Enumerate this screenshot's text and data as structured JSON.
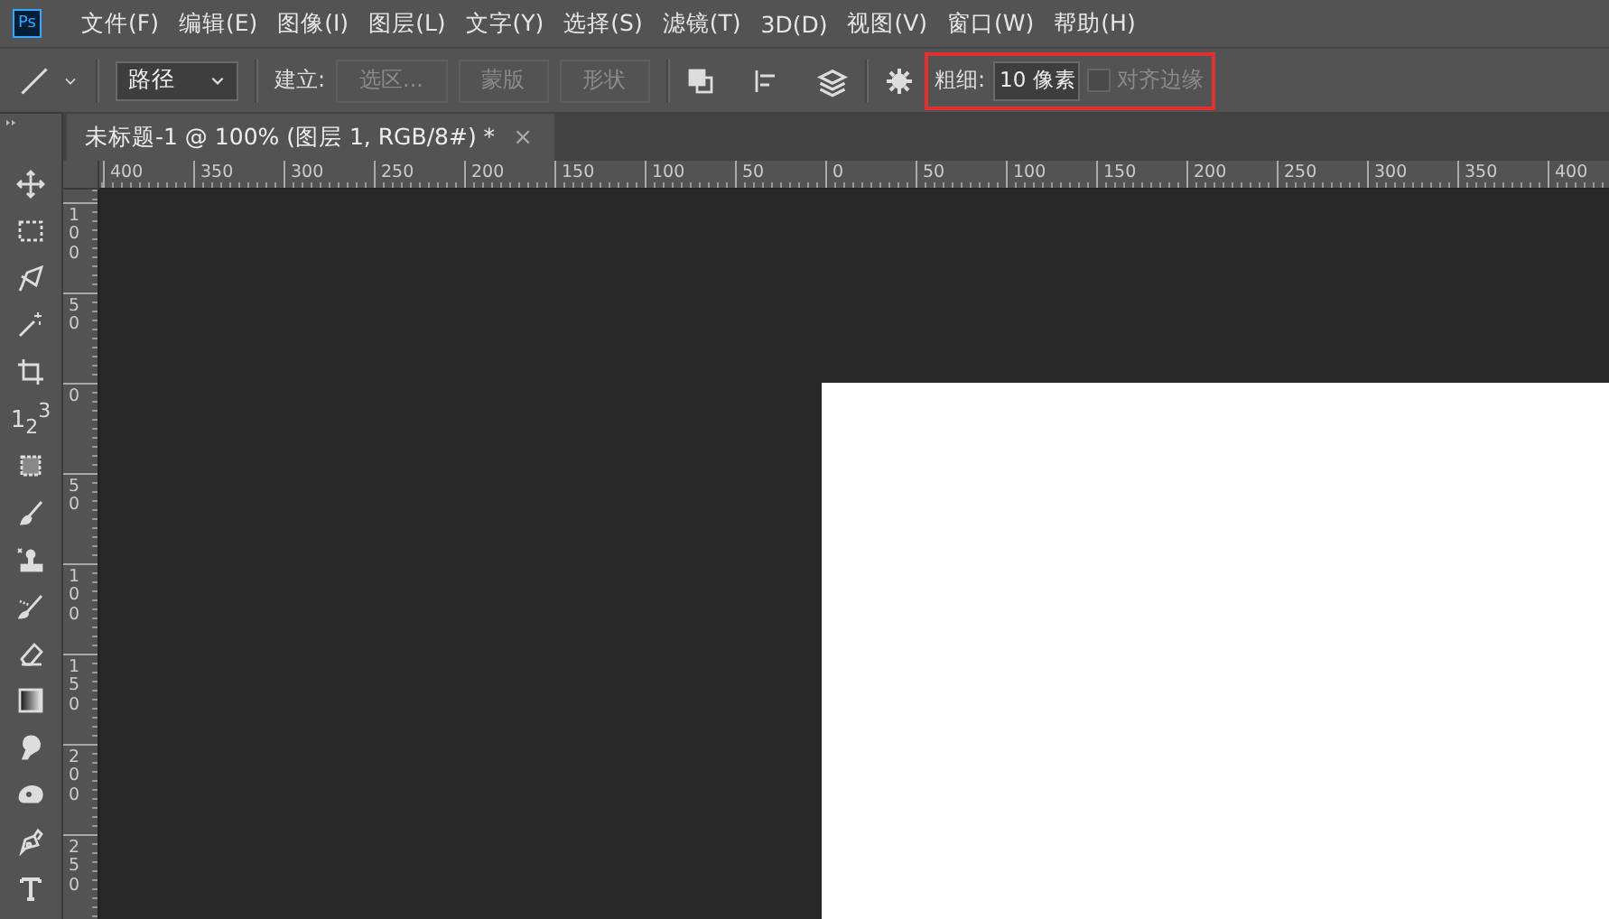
{
  "app": {
    "logo": "Ps"
  },
  "menu": [
    "文件(F)",
    "编辑(E)",
    "图像(I)",
    "图层(L)",
    "文字(Y)",
    "选择(S)",
    "滤镜(T)",
    "3D(D)",
    "视图(V)",
    "窗口(W)",
    "帮助(H)"
  ],
  "options": {
    "mode": "路径",
    "make_label": "建立:",
    "make_buttons": [
      {
        "label": "选区...",
        "disabled": true
      },
      {
        "label": "蒙版",
        "disabled": true
      },
      {
        "label": "形状",
        "disabled": true
      }
    ],
    "weight": {
      "label": "粗细:",
      "value": "10 像素",
      "highlighted": true
    },
    "align_edges": {
      "label": "对齐边缘",
      "checked": false,
      "disabled": true
    }
  },
  "document_tab": {
    "title": "未标题-1 @ 100% (图层 1, RGB/8#) *",
    "close": "×",
    "selected": true
  },
  "tools": {
    "count_glyph": "1$_{2}$$^{3}$"
  },
  "rulers": {
    "horizontal": [
      "400",
      "350",
      "300",
      "250",
      "200",
      "150",
      "100",
      "50",
      "0",
      "50",
      "100",
      "150",
      "200",
      "250",
      "300",
      "350",
      "400"
    ],
    "vertical": [
      "100",
      "50",
      "0",
      "50",
      "100",
      "150",
      "200",
      "250"
    ]
  }
}
